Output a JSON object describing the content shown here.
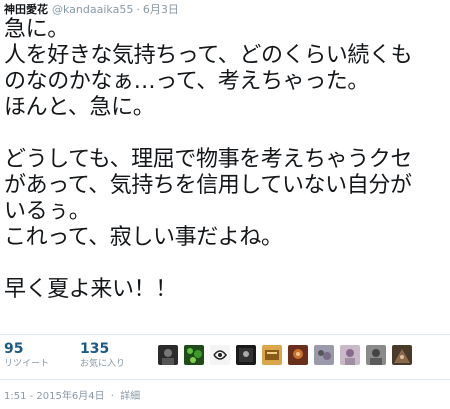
{
  "tweet": {
    "user_name": "神田愛花",
    "handle": "@kandaaika55",
    "separator": "·",
    "date": "6月3日",
    "lines": [
      "急に。",
      "人を好きな気持ちって、どのくらい続くも",
      "のなのかなぁ…って、考えちゃった。",
      "ほんと、急に。",
      "",
      "どうしても、理屈で物事を考えちゃうクセ",
      "があって、気持ちを信用していない自分が",
      "いるぅ。",
      "これって、寂しい事だよね。",
      "",
      "早く夏よ来い！！"
    ]
  },
  "stats": {
    "retweets": {
      "count": "95",
      "label": "リツイート"
    },
    "favorites": {
      "count": "135",
      "label": "お気に入り"
    }
  },
  "footer": {
    "time": "1:51 - 2015年6月4日",
    "separator": "·",
    "details_link": "詳細"
  },
  "avatar_colors": [
    "#2b2b2b",
    "#3a7a2a",
    "#e9e9e9",
    "#1a1a1a",
    "#c8892e",
    "#8a4b2e",
    "#7a7a8a",
    "#a08fa0",
    "#5a5a5a",
    "#6a4a3a"
  ]
}
